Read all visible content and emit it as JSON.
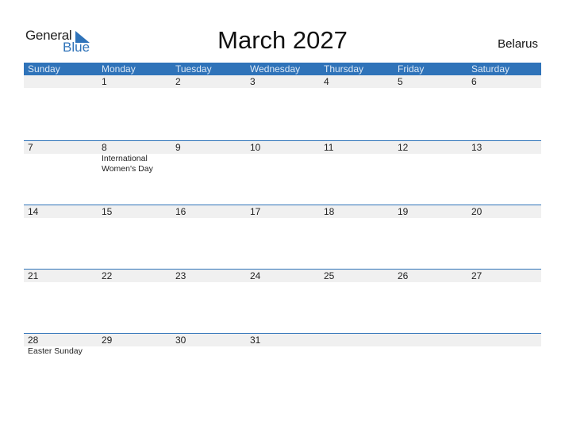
{
  "brand": {
    "line1": "General",
    "line2": "Blue"
  },
  "title": "March 2027",
  "country": "Belarus",
  "colors": {
    "accent": "#2f73b9",
    "shade": "#f0f0f0"
  },
  "weekdays": [
    "Sunday",
    "Monday",
    "Tuesday",
    "Wednesday",
    "Thursday",
    "Friday",
    "Saturday"
  ],
  "weeks": [
    {
      "days": [
        "",
        "1",
        "2",
        "3",
        "4",
        "5",
        "6"
      ],
      "events": [
        "",
        "",
        "",
        "",
        "",
        "",
        ""
      ]
    },
    {
      "days": [
        "7",
        "8",
        "9",
        "10",
        "11",
        "12",
        "13"
      ],
      "events": [
        "",
        "International Women's Day",
        "",
        "",
        "",
        "",
        ""
      ]
    },
    {
      "days": [
        "14",
        "15",
        "16",
        "17",
        "18",
        "19",
        "20"
      ],
      "events": [
        "",
        "",
        "",
        "",
        "",
        "",
        ""
      ]
    },
    {
      "days": [
        "21",
        "22",
        "23",
        "24",
        "25",
        "26",
        "27"
      ],
      "events": [
        "",
        "",
        "",
        "",
        "",
        "",
        ""
      ]
    },
    {
      "days": [
        "28",
        "29",
        "30",
        "31",
        "",
        "",
        ""
      ],
      "events": [
        "Easter Sunday",
        "",
        "",
        "",
        "",
        "",
        ""
      ]
    }
  ]
}
